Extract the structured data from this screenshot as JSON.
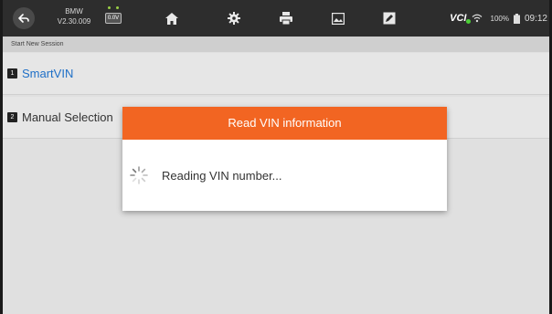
{
  "vehicle": {
    "make": "BMW",
    "version": "V2.30.009"
  },
  "battery_voltage": "0.0V",
  "status": {
    "vci_label": "VCI",
    "battery_pct": "100%",
    "time": "09:12"
  },
  "breadcrumb": "Start New Session",
  "options": [
    {
      "number": "1",
      "label": "SmartVIN"
    },
    {
      "number": "2",
      "label": "Manual Selection"
    }
  ],
  "modal": {
    "title": "Read VIN information",
    "message": "Reading VIN number..."
  },
  "icons": [
    "back-icon",
    "home-icon",
    "settings-icon",
    "print-icon",
    "image-icon",
    "edit-icon",
    "wifi-icon",
    "battery-icon",
    "spinner-icon"
  ],
  "colors": {
    "accent": "#f26522",
    "link": "#1e6fc7",
    "topbar": "#2d2d2d"
  }
}
